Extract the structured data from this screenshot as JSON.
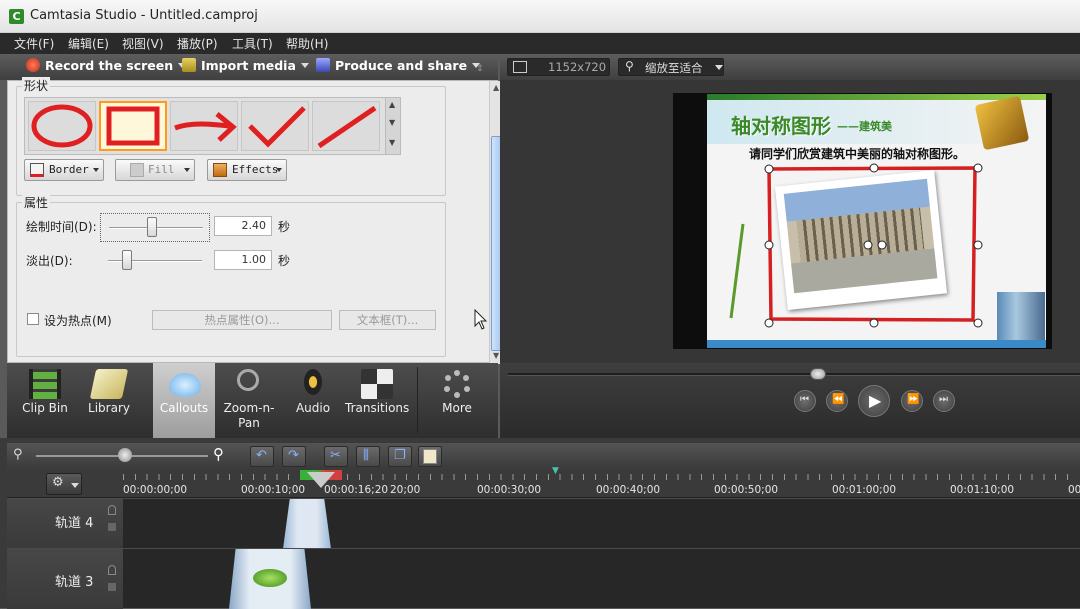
{
  "window": {
    "title": "Camtasia Studio - Untitled.camproj"
  },
  "menu": [
    "文件(F)",
    "编辑(E)",
    "视图(V)",
    "播放(P)",
    "工具(T)",
    "帮助(H)"
  ],
  "toolbar": {
    "record": "Record the screen",
    "import": "Import media",
    "produce": "Produce and share"
  },
  "preview_toolbar": {
    "resolution": "1152x720",
    "zoom": "缩放至适合"
  },
  "callouts_panel": {
    "shapes_title": "形状",
    "shapes": [
      "circle",
      "rectangle",
      "arrow",
      "checkmark",
      "line"
    ],
    "selected_shape": "rectangle",
    "border_label": "Border",
    "fill_label": "Fill",
    "effects_label": "Effects",
    "properties_title": "属性",
    "draw_time_label": "绘制时间(D):",
    "draw_time_value": "2.40",
    "draw_time_unit": "秒",
    "fade_out_label": "淡出(D):",
    "fade_out_value": "1.00",
    "fade_out_unit": "秒",
    "hotspot_label": "设为热点(M)",
    "hotspot_props": "热点属性(O)...",
    "text_box": "文本框(T)..."
  },
  "tabs": [
    {
      "label": "Clip Bin"
    },
    {
      "label": "Library"
    },
    {
      "label": "Callouts"
    },
    {
      "label": "Zoom-n-Pan"
    },
    {
      "label": "Audio"
    },
    {
      "label": "Transitions"
    },
    {
      "label": "More"
    }
  ],
  "slide": {
    "title": "轴对称图形",
    "subtitle": "——建筑美",
    "prompt": "请同学们欣赏建筑中美丽的轴对称图形。"
  },
  "timeline": {
    "ruler_ticks": [
      "00:00:00;00",
      "00:00:10;00",
      "00:00:16;20",
      "20;00",
      "00:00:30;00",
      "00:00:40;00",
      "00:00:50;00",
      "00:01:00;00",
      "00:01:10;00",
      "00"
    ],
    "tracks": [
      {
        "name": "轨道 4"
      },
      {
        "name": "轨道 3"
      }
    ]
  },
  "colors": {
    "accent_orange": "#ff9a1a",
    "shape_red": "#e02020",
    "title_green": "#3a8a2a"
  }
}
